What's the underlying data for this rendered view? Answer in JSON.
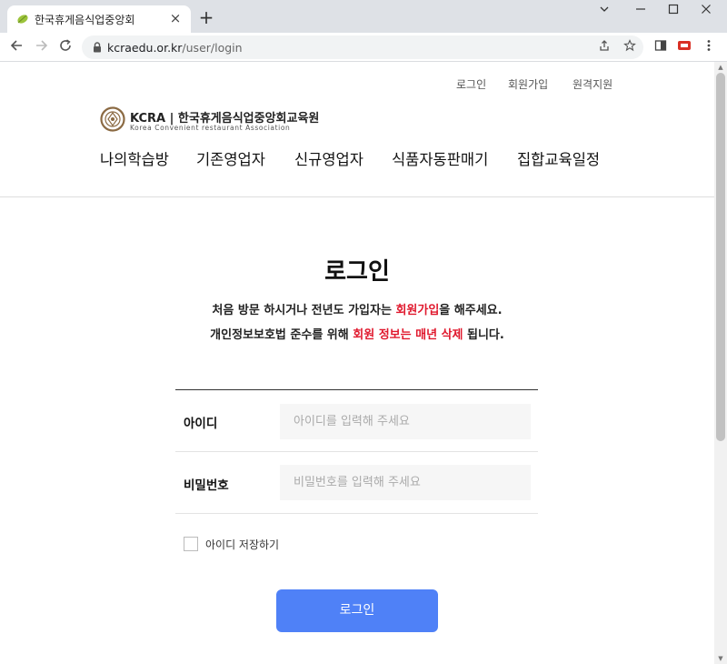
{
  "browser": {
    "tab_title": "한국휴게음식업중앙회",
    "tab_close": "×",
    "new_tab": "+",
    "url_domain": "kcraedu.or.kr",
    "url_path": "/user/login",
    "window_controls": [
      "minimize",
      "maximize",
      "close"
    ]
  },
  "header": {
    "util_links": [
      "로그인",
      "회원가입",
      "원격지원"
    ],
    "logo_main": "KCRA | 한국휴게음식업중앙회교육원",
    "logo_sub": "Korea Convenient restaurant Association",
    "nav": [
      "나의학습방",
      "기존영업자",
      "신규영업자",
      "식품자동판매기",
      "집합교육일정"
    ]
  },
  "login": {
    "title": "로그인",
    "notice1_a": "처음 방문 하시거나 전년도 가입자는 ",
    "notice1_red": "회원가입",
    "notice1_b": "을 해주세요.",
    "notice2_a": "개인정보보호법 준수를 위해 ",
    "notice2_red": "회원 정보는 매년 삭제",
    "notice2_b": " 됩니다.",
    "id_label": "아이디",
    "id_placeholder": "아이디를 입력해 주세요",
    "pw_label": "비밀번호",
    "pw_placeholder": "비밀번호를 입력해 주세요",
    "remember_label": "아이디 저장하기",
    "button_label": "로그인"
  },
  "colors": {
    "accent": "#4f81f7",
    "highlight": "#e0182d"
  }
}
